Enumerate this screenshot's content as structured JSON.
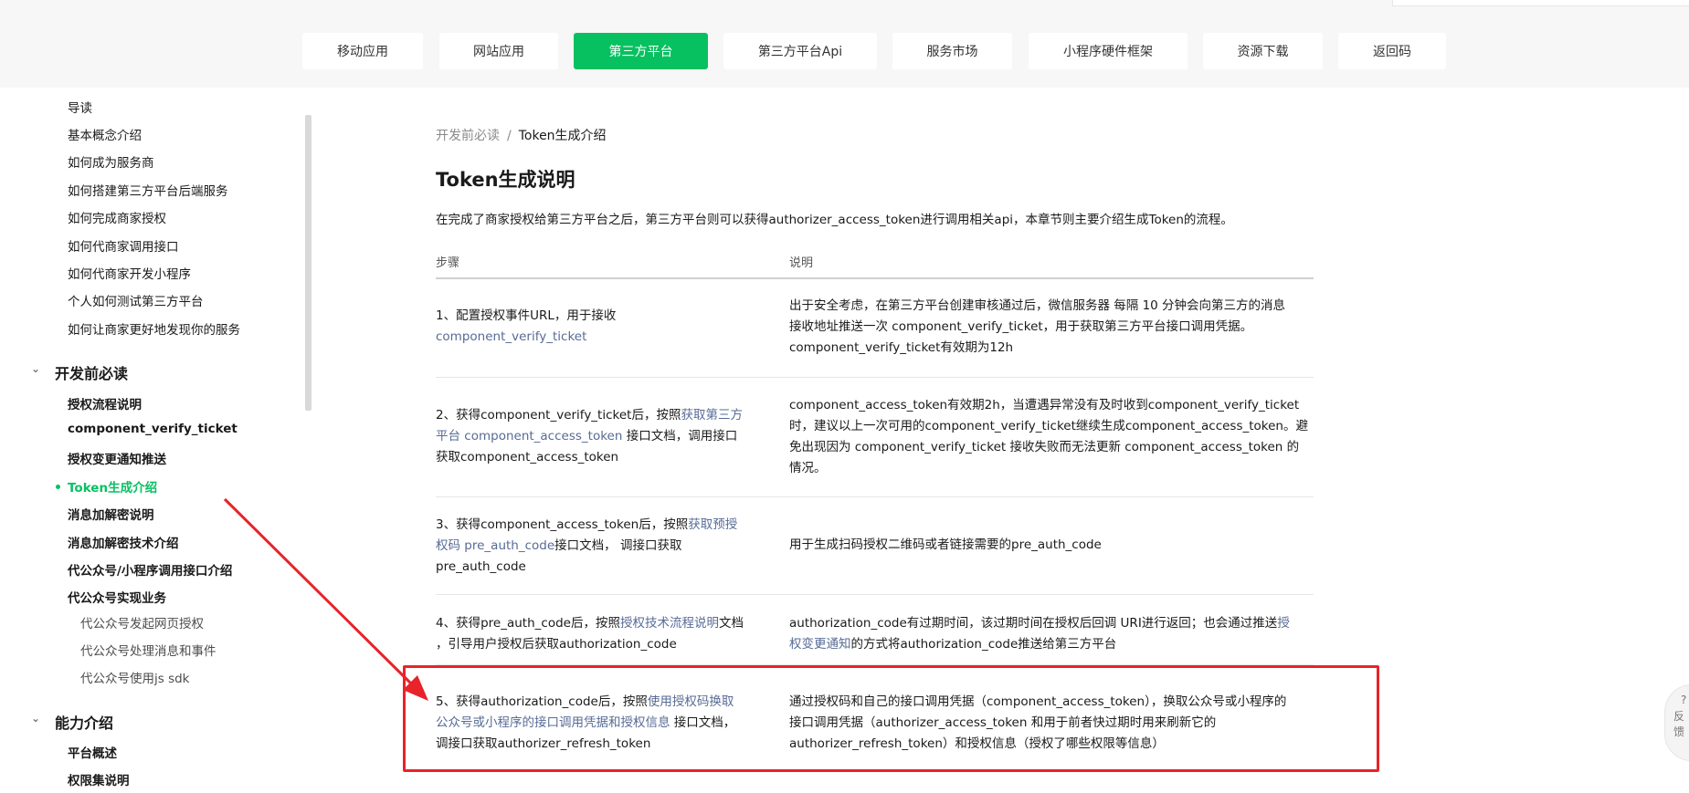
{
  "nav": {
    "items": [
      "移动应用",
      "网站应用",
      "第三方平台",
      "第三方平台Api",
      "服务市场",
      "小程序硬件框架",
      "资源下载",
      "返回码"
    ],
    "active_index": 2
  },
  "sidebar": {
    "intro_items": [
      "导读",
      "基本概念介绍",
      "如何成为服务商",
      "如何搭建第三方平台后端服务",
      "如何完成商家授权",
      "如何代商家调用接口",
      "如何代商家开发小程序",
      "个人如何测试第三方平台",
      "如何让商家更好地发现你的服务"
    ],
    "section_1": "开发前必读",
    "section_1_items": [
      "授权流程说明",
      "component_verify_ticket",
      "授权变更通知推送",
      "Token生成介绍",
      "消息加解密说明",
      "消息加解密技术介绍",
      "代公众号/小程序调用接口介绍",
      "代公众号实现业务"
    ],
    "section_1_sub_items": [
      "代公众号发起网页授权",
      "代公众号处理消息和事件",
      "代公众号使用js sdk"
    ],
    "section_2": "能力介绍",
    "section_2_items": [
      "平台概述",
      "权限集说明"
    ],
    "chevron": "⌄"
  },
  "breadcrumb": {
    "parent": "开发前必读",
    "separator": "/",
    "current": "Token生成介绍"
  },
  "page": {
    "title": "Token生成说明",
    "intro": "在完成了商家授权给第三方平台之后，第三方平台则可以获得authorizer_access_token进行调用相关api，本章节则主要介绍生成Token的流程。"
  },
  "table": {
    "headers": [
      "步骤",
      "说明"
    ],
    "rows": [
      {
        "step": [
          {
            "t": "1、配置授权事件URL，用于接收"
          },
          {
            "br": true
          },
          {
            "t": "component_verify_ticket",
            "link": true
          }
        ],
        "desc": [
          {
            "t": "出于安全考虑，在第三方平台创建审核通过后，微信服务器 每隔 10 分钟会向第三方的消息"
          },
          {
            "br": true
          },
          {
            "t": "接收地址推送一次 component_verify_ticket，用于获取第三方平台接口调用凭据。"
          },
          {
            "br": true
          },
          {
            "t": "component_verify_ticket有效期为12h"
          }
        ]
      },
      {
        "step": [
          {
            "t": "2、获得component_verify_ticket后，按照"
          },
          {
            "t": "获取第三方",
            "link": true
          },
          {
            "br": true
          },
          {
            "t": "平台 component_access_token",
            "link": true
          },
          {
            "t": " 接口文档，调用接口"
          },
          {
            "br": true
          },
          {
            "t": "获取component_access_token"
          }
        ],
        "desc": [
          {
            "t": "component_access_token有效期2h，当遭遇异常没有及时收到component_verify_ticket"
          },
          {
            "br": true
          },
          {
            "t": "时，建议以上一次可用的component_verify_ticket继续生成component_access_token。避"
          },
          {
            "br": true
          },
          {
            "t": "免出现因为 component_verify_ticket 接收失败而无法更新 component_access_token 的"
          },
          {
            "br": true
          },
          {
            "t": "情况。"
          }
        ]
      },
      {
        "step": [
          {
            "t": "3、获得component_access_token后，按照"
          },
          {
            "t": "获取预授",
            "link": true
          },
          {
            "br": true
          },
          {
            "t": "权码 pre_auth_code",
            "link": true
          },
          {
            "t": "接口文档， 调接口获取"
          },
          {
            "br": true
          },
          {
            "t": "pre_auth_code"
          }
        ],
        "desc": [
          {
            "t": "用于生成扫码授权二维码或者链接需要的pre_auth_code"
          }
        ]
      },
      {
        "step": [
          {
            "t": "4、获得pre_auth_code后，按照"
          },
          {
            "t": "授权技术流程说明",
            "link": true
          },
          {
            "t": "文档"
          },
          {
            "br": true
          },
          {
            "t": "，引导用户授权后获取authorization_code"
          }
        ],
        "desc": [
          {
            "t": "authorization_code有过期时间，该过期时间在授权后回调 URI进行返回；也会通过推送"
          },
          {
            "t": "授",
            "link": true
          },
          {
            "br": true
          },
          {
            "t": "权变更通知",
            "link": true
          },
          {
            "t": "的方式将authorization_code推送给第三方平台"
          }
        ]
      },
      {
        "step": [
          {
            "t": "5、获得authorization_code后，按照"
          },
          {
            "t": "使用授权码换取",
            "link": true
          },
          {
            "br": true
          },
          {
            "t": "公众号或小程序的接口调用凭据和授权信息",
            "link": true
          },
          {
            "t": " 接口文档，"
          },
          {
            "br": true
          },
          {
            "t": "调接口获取authorizer_refresh_token"
          }
        ],
        "desc": [
          {
            "t": "通过授权码和自己的接口调用凭据（component_access_token），换取公众号或小程序的"
          },
          {
            "br": true
          },
          {
            "t": "接口调用凭据（authorizer_access_token 和用于前者快过期时用来刷新它的"
          },
          {
            "br": true
          },
          {
            "t": "authorizer_refresh_token）和授权信息（授权了哪些权限等信息）"
          }
        ]
      }
    ]
  },
  "feedback": {
    "icon": "?",
    "label": "反馈"
  },
  "colors": {
    "brand_green": "#07c160",
    "link_blue": "#576b95",
    "annotation_red": "#e8232a"
  }
}
